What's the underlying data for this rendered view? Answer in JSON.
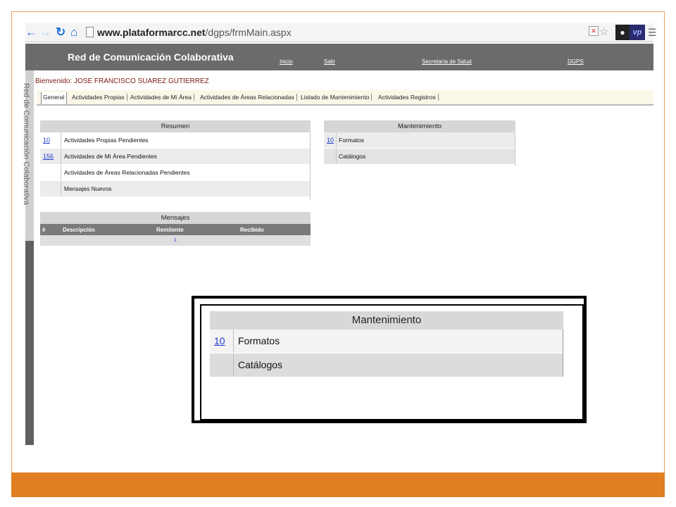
{
  "browser": {
    "url_host": "www.plataformarcc.net",
    "url_path": "/dgps/frmMain.aspx",
    "icons": [
      "back-arrow-icon",
      "forward-arrow-icon",
      "reload-icon",
      "home-icon",
      "page-icon",
      "star-icon",
      "extension-icon",
      "vp-extension-icon",
      "menu-icon"
    ]
  },
  "app": {
    "title": "Red de Comunicación Colaborativa",
    "links": {
      "inicio": "Inicio",
      "salir": "Salir",
      "secretaria": "Secretaría de Salud",
      "dgps": "DGPS"
    },
    "side_label": "Red de Comunicación Colaborativa",
    "welcome": "Bienvenido: JOSE FRANCISCO SUAREZ GUTIERREZ"
  },
  "tabs": [
    {
      "label": "General",
      "active": true
    },
    {
      "label": "Actividades Propias"
    },
    {
      "label": "Actividades de Mi Área"
    },
    {
      "label": "Actividades de Áreas Relacionadas"
    },
    {
      "label": "Listado de Mantenimiento"
    },
    {
      "label": "Actividades Registros"
    }
  ],
  "resumen": {
    "title": "Resumen",
    "rows": [
      {
        "count": "10",
        "label": "Actividades Propias Pendientes"
      },
      {
        "count": "156",
        "label": "Actividades de Mi Área Pendientes"
      },
      {
        "count": "",
        "label": "Actividades de Áreas Relacionadas Pendientes"
      },
      {
        "count": "",
        "label": "Mensajes Nuevos"
      }
    ]
  },
  "mantenimiento": {
    "title": "Mantenimiento",
    "rows": [
      {
        "count": "10",
        "label": "Formatos"
      },
      {
        "count": "",
        "label": "Catálogos"
      }
    ]
  },
  "mensajes": {
    "title": "Mensajes",
    "columns": [
      "#",
      "Descripción",
      "Remitente",
      "Recibido"
    ],
    "pager": "1"
  },
  "zoom": {
    "title": "Mantenimiento",
    "rows": [
      {
        "count": "10",
        "label": "Formatos"
      },
      {
        "count": "",
        "label": "Catálogos"
      }
    ]
  },
  "colors": {
    "accent_orange": "#e07f22",
    "header_gray": "#6b6b6b",
    "link_blue": "#1a3cc8",
    "welcome_red": "#7a1a10"
  }
}
